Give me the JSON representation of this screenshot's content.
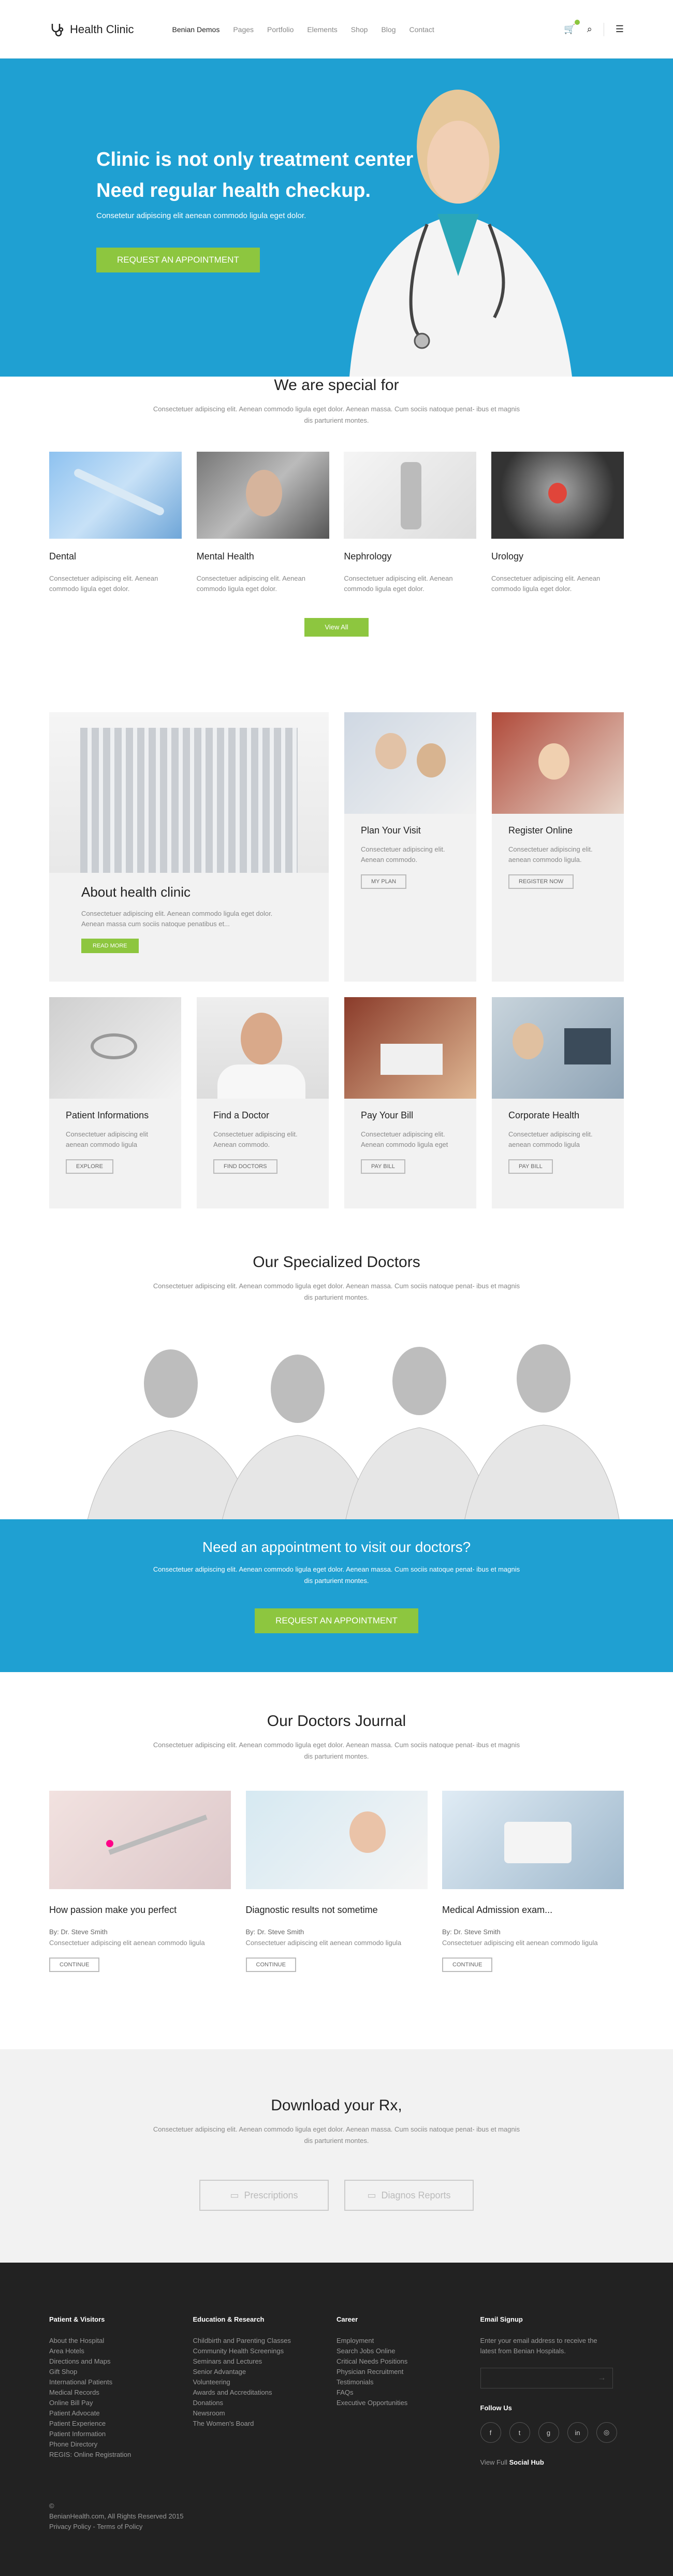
{
  "header": {
    "brand": "Health Clinic",
    "nav": [
      "Benian Demos",
      "Pages",
      "Portfolio",
      "Elements",
      "Shop",
      "Blog",
      "Contact"
    ]
  },
  "hero": {
    "line1": "Clinic is not only treatment center",
    "line2": "Need regular health checkup.",
    "sub": "Consetetur adipiscing elit aenean commodo ligula eget dolor.",
    "cta": "Request an Appointment"
  },
  "special": {
    "title": "We are special for",
    "desc": "Consectetuer adipiscing elit. Aenean commodo ligula eget dolor. Aenean massa. Cum sociis natoque penat- ibus et magnis dis parturient montes.",
    "items": [
      {
        "title": "Dental",
        "text": "Consectetuer adipiscing elit. Aenean commodo ligula eget dolor."
      },
      {
        "title": "Mental Health",
        "text": "Consectetuer adipiscing elit. Aenean commodo ligula eget dolor."
      },
      {
        "title": "Nephrology",
        "text": "Consectetuer adipiscing elit. Aenean commodo ligula eget dolor."
      },
      {
        "title": "Urology",
        "text": "Consectetuer adipiscing elit. Aenean commodo ligula eget dolor."
      }
    ],
    "view_all": "View All"
  },
  "about": {
    "title": "About health clinic",
    "text": "Consectetuer adipiscing elit. Aenean commodo ligula eget dolor. Aenean massa cum sociis natoque penatibus et...",
    "btn": "Read More"
  },
  "cards": [
    {
      "title": "Plan Your Visit",
      "text": "Consectetuer adipiscing elit. Aenean commodo.",
      "btn": "My Plan"
    },
    {
      "title": "Register Online",
      "text": "Consectetuer adipiscing elit. aenean commodo ligula.",
      "btn": "Register Now"
    },
    {
      "title": "Patient Informations",
      "text": "Consectetuer adipiscing elit aenean commodo ligula",
      "btn": "Explore"
    },
    {
      "title": "Find a Doctor",
      "text": "Consectetuer adipiscing elit. Aenean commodo.",
      "btn": "Find Doctors"
    },
    {
      "title": "Pay Your Bill",
      "text": "Consectetuer adipiscing elit. Aenean commodo ligula eget",
      "btn": "Pay Bill"
    },
    {
      "title": "Corporate Health",
      "text": "Consectetuer adipiscing elit. aenean commodo ligula",
      "btn": "Pay Bill"
    }
  ],
  "doctors": {
    "title": "Our Specialized Doctors",
    "desc": "Consectetuer adipiscing elit. Aenean commodo ligula eget dolor. Aenean massa. Cum sociis natoque penat- ibus et magnis dis parturient montes."
  },
  "appt": {
    "title": "Need an appointment to visit our doctors?",
    "desc": "Consectetuer adipiscing elit. Aenean commodo ligula eget dolor. Aenean massa. Cum sociis natoque penat- ibus et magnis dis parturient montes.",
    "cta": "Request an Appointment"
  },
  "journal": {
    "title": "Our Doctors Journal",
    "desc": "Consectetuer adipiscing elit. Aenean commodo ligula eget dolor. Aenean massa. Cum sociis natoque penat- ibus et magnis dis parturient montes.",
    "posts": [
      {
        "title": "How passion make you perfect",
        "by": "By: Dr. Steve Smith",
        "text": "Consectetuer adipiscing elit aenean commodo ligula",
        "btn": "Continue"
      },
      {
        "title": "Diagnostic results not sometime",
        "by": "By: Dr. Steve Smith",
        "text": "Consectetuer adipiscing elit aenean commodo ligula",
        "btn": "Continue"
      },
      {
        "title": "Medical Admission exam...",
        "by": "By: Dr. Steve Smith",
        "text": "Consectetuer adipiscing elit aenean commodo ligula",
        "btn": "Continue"
      }
    ]
  },
  "rx": {
    "title": "Download your Rx,",
    "desc": "Consectetuer adipiscing elit. Aenean commodo ligula eget dolor. Aenean massa. Cum sociis natoque penat- ibus et magnis dis parturient montes.",
    "btn1": "Prescriptions",
    "btn2": "Diagnos Reports"
  },
  "footer": {
    "col1": {
      "title": "Patient & Visitors",
      "items": [
        "About the Hospital",
        "Area Hotels",
        "Directions and Maps",
        "Gift Shop",
        "International Patients",
        "Medical Records",
        "Online Bill Pay",
        "Patient Advocate",
        "Patient Experience",
        "Patient Information",
        "Phone Directory",
        "REGIS: Online Registration"
      ]
    },
    "col2": {
      "title": "Education & Research",
      "items": [
        "Childbirth and Parenting Classes",
        "Community Health Screenings",
        "Seminars and Lectures",
        "Senior Advantage",
        "Volunteering",
        "Awards and Accreditations",
        "Donations",
        "Newsroom",
        "The Women's Board"
      ]
    },
    "col3": {
      "title": "Career",
      "items": [
        "Employment",
        "Search Jobs Online",
        "Critical Needs Positions",
        "Physician Recruitment",
        "Testimonials",
        "FAQs",
        "Executive Opportunities"
      ]
    },
    "signup": {
      "title": "Email Signup",
      "text": "Enter your email address to receive the latest from Benian Hospitals.",
      "follow": "Follow Us",
      "social": [
        "f",
        "t",
        "g",
        "in",
        "◎"
      ],
      "view_full": "View Full",
      "social_hub": "Social Hub"
    },
    "copy1": "©",
    "copy2": "BenianHealth.com, All Rights Reserved 2015",
    "copy3": "Privacy Policy - Terms of Policy"
  }
}
